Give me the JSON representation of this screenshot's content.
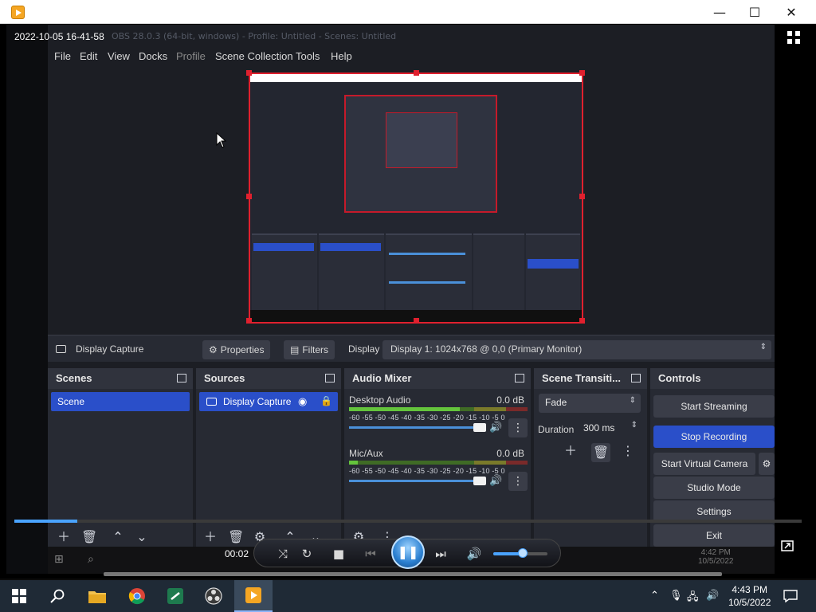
{
  "window": {
    "min_glyph": "—",
    "max_glyph": "☐",
    "close_glyph": "✕"
  },
  "video": {
    "timestamp": "2022-10-05 16-41-58",
    "ghost_title": "OBS 28.0.3 (64-bit, windows) - Profile: Untitled - Scenes: Untitled",
    "menu": [
      "File",
      "Edit",
      "View",
      "Docks",
      "Profile",
      "Scene Collection",
      "Tools",
      "Help"
    ],
    "source_bar": {
      "source_name": "Display Capture",
      "properties": "Properties",
      "filters": "Filters",
      "display_label": "Display",
      "display_value": "Display 1: 1024x768 @ 0,0 (Primary Monitor)"
    },
    "docks": {
      "scenes": {
        "title": "Scenes",
        "items": [
          "Scene"
        ]
      },
      "sources": {
        "title": "Sources",
        "items": [
          "Display Capture"
        ]
      },
      "mixer": {
        "title": "Audio Mixer",
        "scale": "-60 -55 -50 -45 -40 -35 -30 -25 -20 -15 -10  -5   0",
        "channels": [
          {
            "name": "Desktop Audio",
            "db": "0.0 dB",
            "level": 0.62
          },
          {
            "name": "Mic/Aux",
            "db": "0.0 dB",
            "level": 0.05
          }
        ]
      },
      "transitions": {
        "title": "Scene Transiti...",
        "type": "Fade",
        "duration_label": "Duration",
        "duration_value": "300 ms"
      },
      "controls": {
        "title": "Controls",
        "buttons": [
          "Start Streaming",
          "Stop Recording",
          "Start Virtual Camera",
          "Studio Mode",
          "Settings",
          "Exit"
        ]
      }
    },
    "inner_clock": {
      "time": "4:42 PM",
      "date": "10/5/2022"
    }
  },
  "player": {
    "elapsed": "00:02",
    "seek_progress": 0.08,
    "volume": 0.55
  },
  "taskbar": {
    "time": "4:43 PM",
    "date": "10/5/2022"
  },
  "colors": {
    "accent": "#2a4fc9",
    "selection_red": "#e0202e",
    "taskbar": "#1f2a36"
  }
}
